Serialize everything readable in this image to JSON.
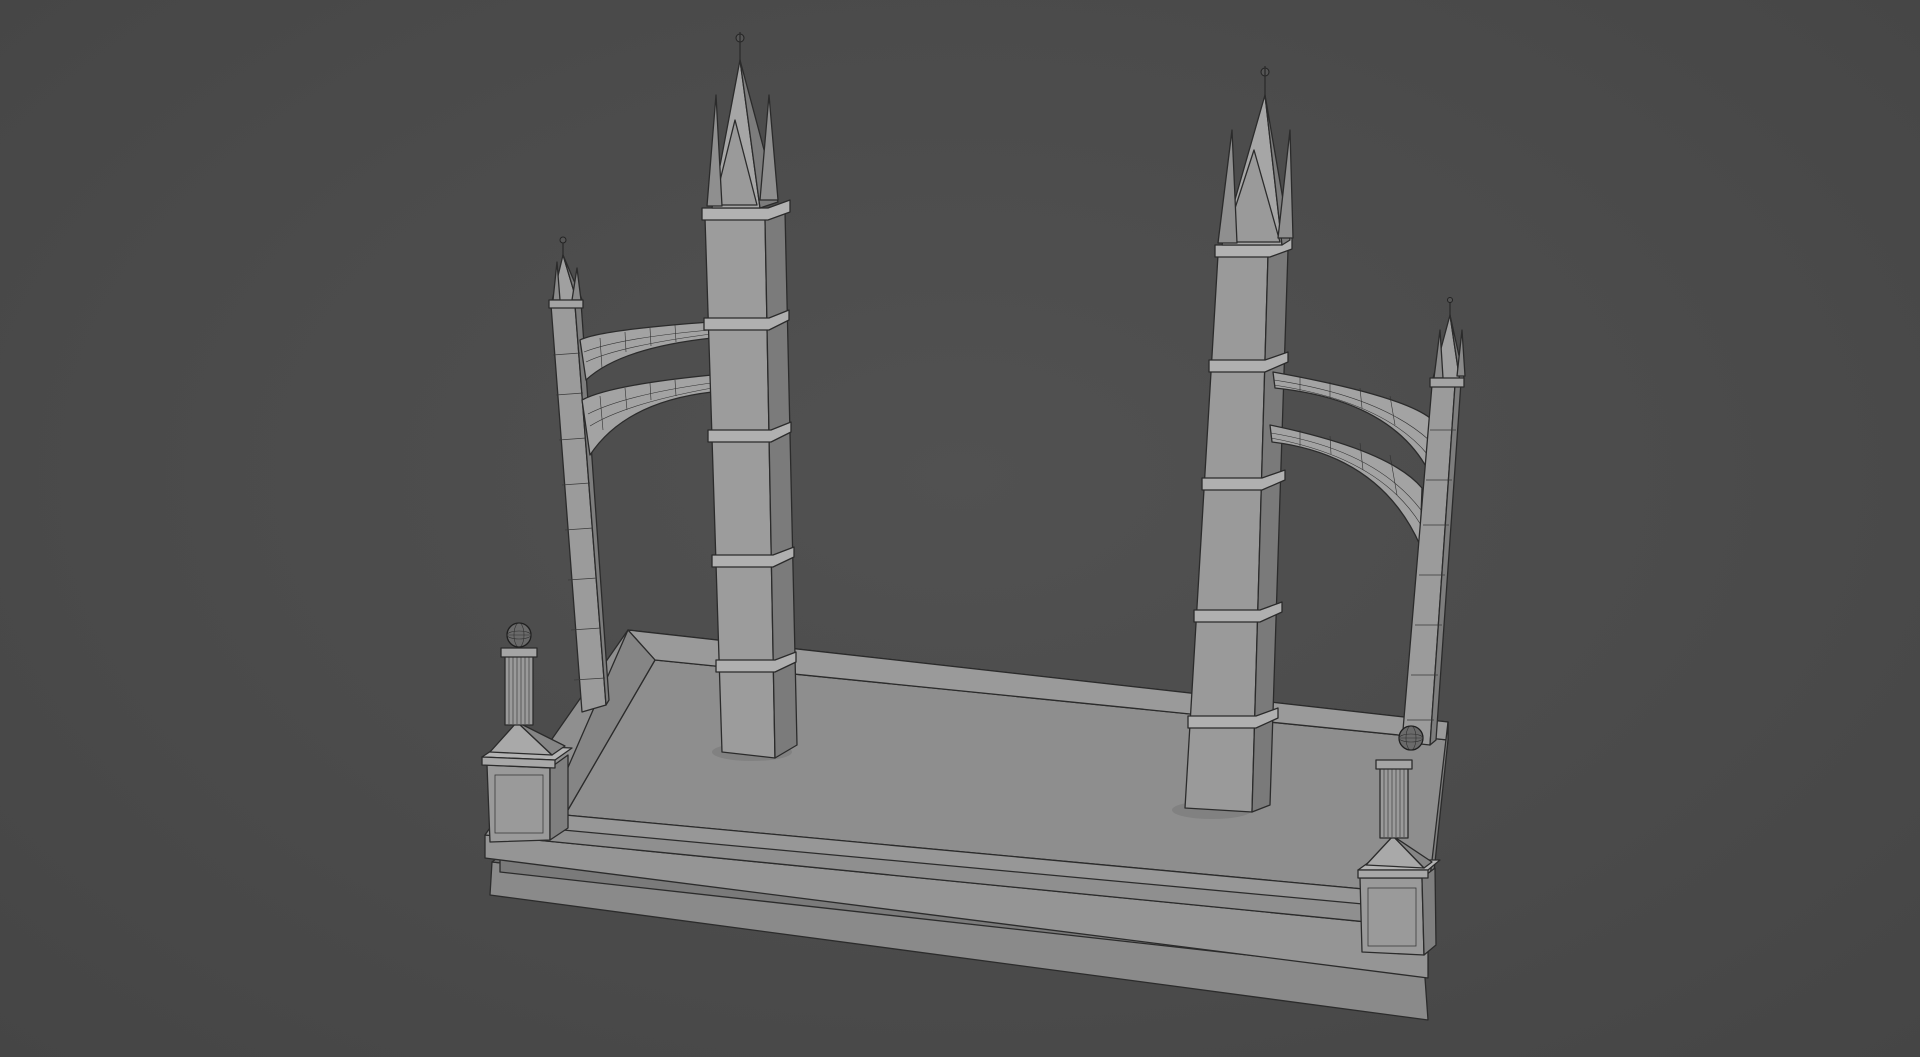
{
  "viewport": {
    "background": "#4a4a4a",
    "mesh_color": "#8f8f8f",
    "wire_color": "#2b2b2b"
  },
  "scene": {
    "objects": [
      "base-platform",
      "left-front-post",
      "right-front-post",
      "left-tall-spire-tower",
      "right-tall-spire-tower",
      "left-buttress-pillar",
      "right-buttress-pillar",
      "left-flying-buttress-arches",
      "right-flying-buttress-arches"
    ]
  }
}
